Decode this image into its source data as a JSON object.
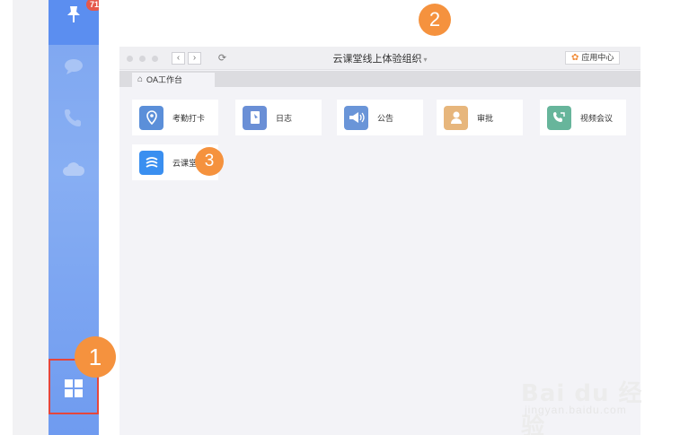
{
  "sidebar": {
    "badge": "71",
    "icons": [
      "pin-icon",
      "chat-icon",
      "phone-icon",
      "cloud-icon",
      "apps-grid-icon"
    ]
  },
  "markers": {
    "one": "1",
    "two": "2",
    "three": "3"
  },
  "window": {
    "title": "云课堂线上体验组织",
    "app_center_label": "应用中心",
    "tab_label": "OA工作台"
  },
  "apps": [
    {
      "label": "考勤打卡",
      "icon": "location-pin-icon",
      "color": "#5b8fd9"
    },
    {
      "label": "日志",
      "icon": "notebook-icon",
      "color": "#6a8fd6"
    },
    {
      "label": "公告",
      "icon": "megaphone-icon",
      "color": "#6a95d8"
    },
    {
      "label": "审批",
      "icon": "person-icon",
      "color": "#e7b67c"
    },
    {
      "label": "视频会议",
      "icon": "video-call-icon",
      "color": "#67b59b"
    },
    {
      "label": "云课堂",
      "icon": "cloud-classroom-icon",
      "color": "#3a8ff0"
    }
  ],
  "watermark": {
    "main": "Bai du 经验",
    "sub": "jingyan.baidu.com"
  },
  "colors": {
    "accent": "#f5923e",
    "highlight": "#e5463c",
    "sidebar": "#7ea6f0"
  }
}
